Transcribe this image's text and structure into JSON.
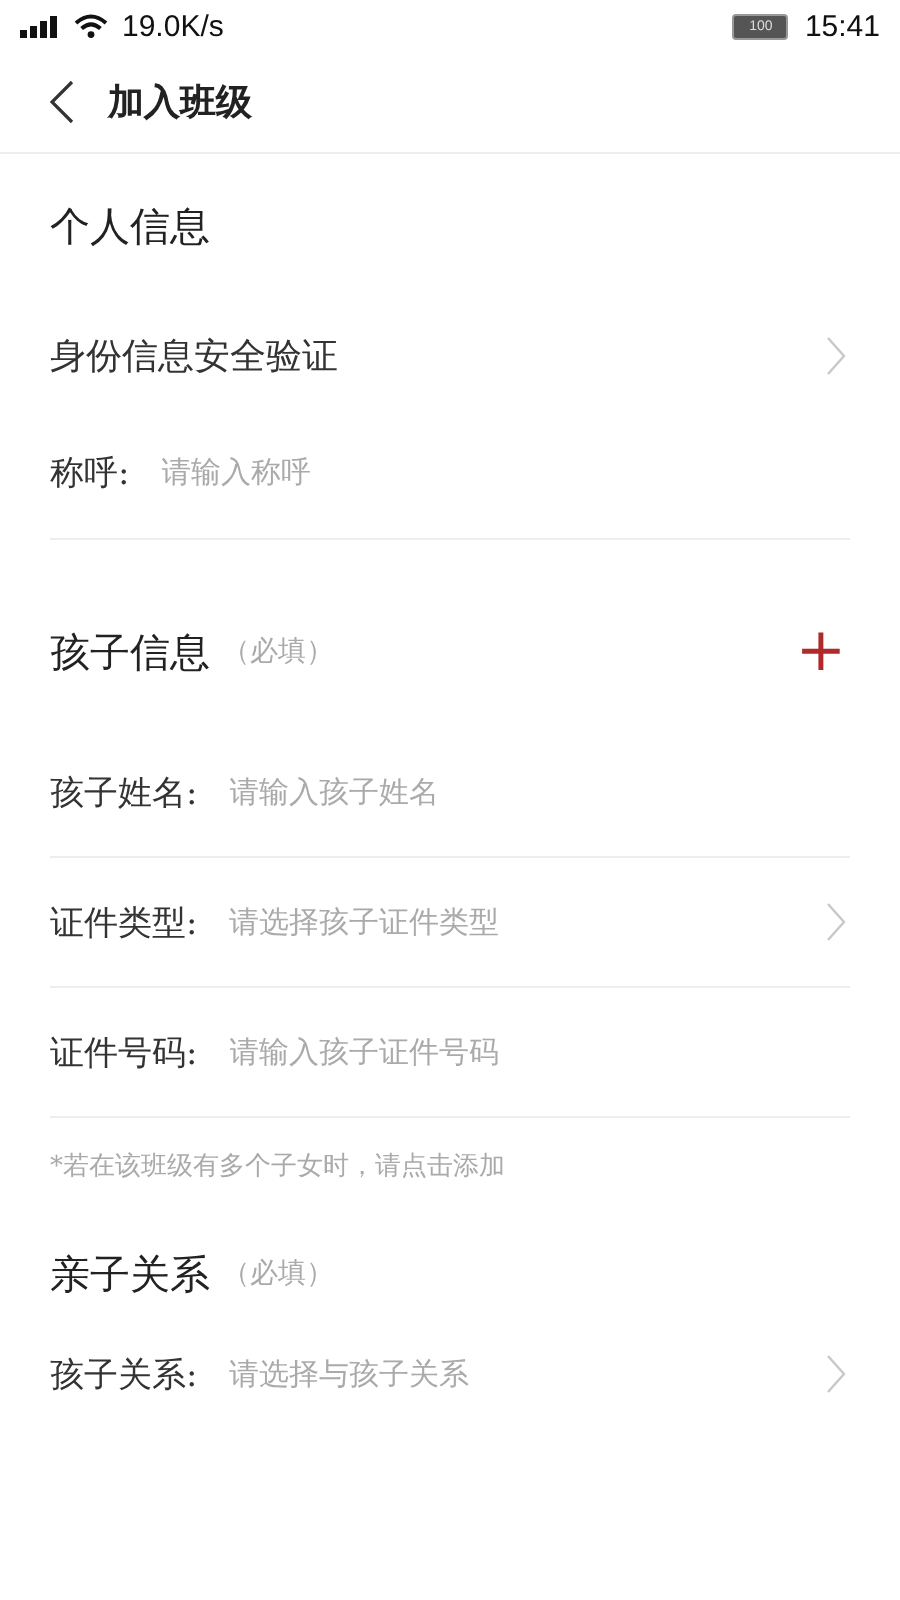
{
  "status_bar": {
    "speed": "19.0K/s",
    "battery": "100",
    "time": "15:41"
  },
  "header": {
    "title": "加入班级"
  },
  "sections": [
    {
      "kind": "personal",
      "title": "个人信息",
      "rows": [
        {
          "kind": "link",
          "label": "身份信息安全验证"
        },
        {
          "kind": "input",
          "label": "称呼:",
          "placeholder": "请输入称呼"
        }
      ]
    },
    {
      "kind": "child",
      "title": "孩子信息",
      "required": "（必填）",
      "add": "+",
      "rows": [
        {
          "kind": "input",
          "label": "孩子姓名:",
          "placeholder": "请输入孩子姓名"
        },
        {
          "kind": "select",
          "label": "证件类型:",
          "placeholder": "请选择孩子证件类型"
        },
        {
          "kind": "input",
          "label": "证件号码:",
          "placeholder": "请输入孩子证件号码"
        }
      ],
      "note": "*若在该班级有多个子女时，请点击添加"
    },
    {
      "kind": "relation",
      "title": "亲子关系",
      "required": "（必填）",
      "rows": [
        {
          "kind": "select",
          "label": "孩子关系:",
          "placeholder": "请选择与孩子关系"
        }
      ]
    }
  ]
}
